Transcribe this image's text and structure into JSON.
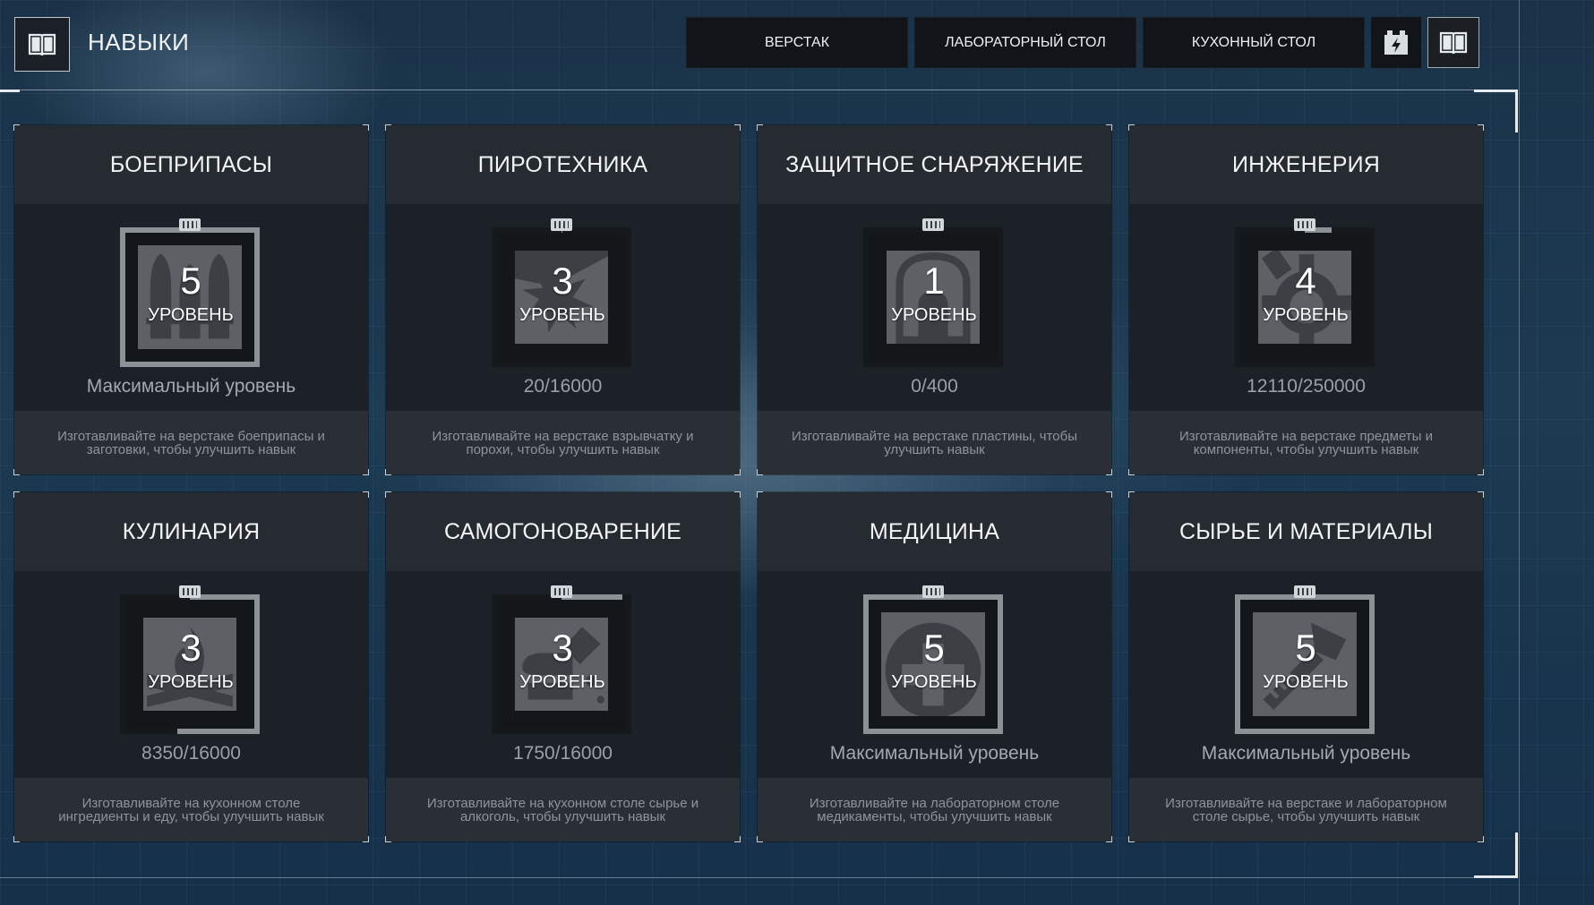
{
  "header": {
    "title": "НАВЫКИ"
  },
  "tabs": [
    {
      "label": "ВЕРСТАК"
    },
    {
      "label": "ЛАБОРАТОРНЫЙ СТОЛ"
    },
    {
      "label": "КУХОННЫЙ СТОЛ"
    }
  ],
  "icons": {
    "header": "book-icon",
    "battery_tab": "battery-icon",
    "skills_tab": "book-icon"
  },
  "level_label": "УРОВЕНЬ",
  "skills": [
    {
      "name": "БОЕПРИПАСЫ",
      "level": "5",
      "progress": "Максимальный уровень",
      "ratio": 1.0,
      "max": true,
      "icon": "ammo-icon",
      "desc": "Изготавливайте на верстаке боеприпасы и заготовки, чтобы улучшить навык"
    },
    {
      "name": "ПИРОТЕХНИКА",
      "level": "3",
      "progress": "20/16000",
      "ratio": 0.00125,
      "max": false,
      "icon": "explosion-icon",
      "desc": "Изготавливайте на верстаке взрывчатку и порохи, чтобы улучшить навык"
    },
    {
      "name": "ЗАЩИТНОЕ СНАРЯЖЕНИЕ",
      "level": "1",
      "progress": "0/400",
      "ratio": 0.0,
      "max": false,
      "icon": "armor-icon",
      "desc": "Изготавливайте на верстаке пластины, чтобы улучшить навык"
    },
    {
      "name": "ИНЖЕНЕРИЯ",
      "level": "4",
      "progress": "12110/250000",
      "ratio": 0.04844,
      "max": false,
      "icon": "gear-icon",
      "desc": "Изготавливайте на верстаке предметы и компоненты, чтобы улучшить навык"
    },
    {
      "name": "КУЛИНАРИЯ",
      "level": "3",
      "progress": "8350/16000",
      "ratio": 0.521875,
      "max": false,
      "icon": "campfire-icon",
      "desc": "Изготавливайте на кухонном столе ингредиенты и еду, чтобы улучшить навык"
    },
    {
      "name": "САМОГОНОВАРЕНИЕ",
      "level": "3",
      "progress": "1750/16000",
      "ratio": 0.109375,
      "max": false,
      "icon": "bottle-icon",
      "desc": "Изготавливайте на кухонном столе сырье и алкоголь, чтобы улучшить навык"
    },
    {
      "name": "МЕДИЦИНА",
      "level": "5",
      "progress": "Максимальный уровень",
      "ratio": 1.0,
      "max": true,
      "icon": "medical-cross-icon",
      "desc": "Изготавливайте на лабораторном столе медикаменты, чтобы улучшить навык"
    },
    {
      "name": "СЫРЬЕ И МАТЕРИАЛЫ",
      "level": "5",
      "progress": "Максимальный уровень",
      "ratio": 1.0,
      "max": true,
      "icon": "hammer-icon",
      "desc": "Изготавливайте на верстаке и лабораторном столе сырье, чтобы улучшить навык"
    }
  ]
}
